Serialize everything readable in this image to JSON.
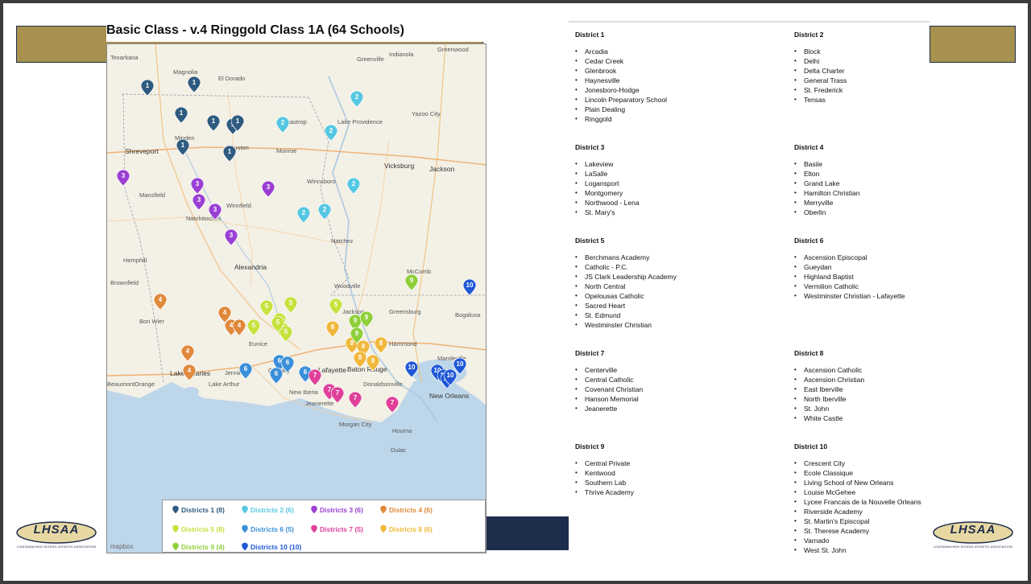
{
  "title": "Basic Class - v.4 Ringgold Class 1A (64 Schools)",
  "logo": {
    "text": "LHSAA",
    "subtitle": "LOUISIANA HIGH SCHOOL ATHLETIC ASSOCIATION"
  },
  "map": {
    "attribution": "mapbox",
    "colors": {
      "1": "#2f5b80",
      "2": "#56c7e2",
      "3": "#9b3fd4",
      "4": "#e0893b",
      "5": "#c6e23f",
      "6": "#3a8fd8",
      "7": "#e0409a",
      "8": "#f0b83a",
      "9": "#8fcf3a",
      "10": "#1f57d6"
    },
    "places": [
      "Texarkana",
      "Magnolia",
      "El Dorado",
      "Greenville",
      "Indianola",
      "Greenwood",
      "Bastrop",
      "Lake Providence",
      "Yazoo City",
      "Minden",
      "Ruston",
      "Monroe",
      "Shreveport",
      "Vicksburg",
      "Jackson",
      "Winnsboro",
      "Mansfield",
      "Winnfield",
      "Natchitoches",
      "Natchez",
      "Alexandria",
      "Hemphill",
      "Brownfield",
      "McComb",
      "Woodville",
      "Bon Wier",
      "Jackson",
      "Greensburg",
      "Bogalusa",
      "Eunice",
      "Crowley",
      "Lafayette",
      "Baton Rouge",
      "Hammond",
      "Mandeville",
      "Lake Charles",
      "Jennings",
      "Orange",
      "Beaumont",
      "New Iberia",
      "Jeanerette",
      "Donaldsonville",
      "New Orleans",
      "Morgan City",
      "Houma",
      "Dulac",
      "Lake Arthur"
    ],
    "pins": [
      {
        "d": "1"
      },
      {
        "d": "1"
      },
      {
        "d": "1"
      },
      {
        "d": "1"
      },
      {
        "d": "1"
      },
      {
        "d": "1"
      },
      {
        "d": "1"
      },
      {
        "d": "1"
      },
      {
        "d": "2"
      },
      {
        "d": "2"
      },
      {
        "d": "2"
      },
      {
        "d": "2"
      },
      {
        "d": "2"
      },
      {
        "d": "2"
      },
      {
        "d": "3"
      },
      {
        "d": "3"
      },
      {
        "d": "3"
      },
      {
        "d": "3"
      },
      {
        "d": "3"
      },
      {
        "d": "3"
      },
      {
        "d": "4"
      },
      {
        "d": "4"
      },
      {
        "d": "4"
      },
      {
        "d": "4"
      },
      {
        "d": "4"
      },
      {
        "d": "4"
      },
      {
        "d": "5"
      },
      {
        "d": "5"
      },
      {
        "d": "5"
      },
      {
        "d": "5"
      },
      {
        "d": "5"
      },
      {
        "d": "5"
      },
      {
        "d": "5"
      },
      {
        "d": "5"
      },
      {
        "d": "6"
      },
      {
        "d": "6"
      },
      {
        "d": "6"
      },
      {
        "d": "6"
      },
      {
        "d": "6"
      },
      {
        "d": "7"
      },
      {
        "d": "7"
      },
      {
        "d": "7"
      },
      {
        "d": "7"
      },
      {
        "d": "7"
      },
      {
        "d": "8"
      },
      {
        "d": "8"
      },
      {
        "d": "8"
      },
      {
        "d": "8"
      },
      {
        "d": "8"
      },
      {
        "d": "8"
      },
      {
        "d": "9"
      },
      {
        "d": "9"
      },
      {
        "d": "9"
      },
      {
        "d": "9"
      },
      {
        "d": "10"
      },
      {
        "d": "10"
      },
      {
        "d": "10"
      },
      {
        "d": "10"
      },
      {
        "d": "10"
      },
      {
        "d": "10"
      },
      {
        "d": "10"
      }
    ],
    "legend": [
      {
        "d": "1",
        "label": "Districts 1 (8)"
      },
      {
        "d": "2",
        "label": "Districts 2 (6)"
      },
      {
        "d": "3",
        "label": "Districts 3 (6)"
      },
      {
        "d": "4",
        "label": "Districts 4 (6)"
      },
      {
        "d": "5",
        "label": "Districts 5 (8)"
      },
      {
        "d": "6",
        "label": "Districts 6 (5)"
      },
      {
        "d": "7",
        "label": "Districts 7 (5)"
      },
      {
        "d": "8",
        "label": "Districts 8 (6)"
      },
      {
        "d": "9",
        "label": "Districts 9 (4)"
      },
      {
        "d": "10",
        "label": "Districts 10 (10)"
      }
    ]
  },
  "districts": [
    {
      "name": "District 1",
      "schools": [
        "Arcadia",
        "Cedar Creek",
        "Glenbrook",
        "Haynesville",
        "Jonesboro-Hodge",
        "Lincoln Preparatory School",
        "Plain Dealing",
        "Ringgold"
      ]
    },
    {
      "name": "District 2",
      "schools": [
        "Block",
        "Delhi",
        "Delta Charter",
        "General Trass",
        "St. Frederick",
        "Tensas"
      ]
    },
    {
      "name": "District 3",
      "schools": [
        "Lakeview",
        "LaSalle",
        "Logansport",
        "Montgomery",
        "Northwood - Lena",
        "St. Mary's"
      ]
    },
    {
      "name": "District 4",
      "schools": [
        "Basile",
        "Elton",
        "Grand Lake",
        "Hamilton Christian",
        "Merryville",
        "Oberlin"
      ]
    },
    {
      "name": "District 5",
      "schools": [
        "Berchmans Academy",
        "Catholic - P.C.",
        "JS Clark Leadership Academy",
        "North Central",
        "Opelousas Catholic",
        "Sacred Heart",
        "St. Edmund",
        "Westminster Christian"
      ]
    },
    {
      "name": "District 6",
      "schools": [
        "Ascension Episcopal",
        "Gueydan",
        "Highland Baptist",
        "Vermilion Catholic",
        "Westminster Christian - Lafayette"
      ]
    },
    {
      "name": "District 7",
      "schools": [
        "Centerville",
        "Central Catholic",
        "Covenant Christian",
        "Hanson Memorial",
        "Jeanerette"
      ]
    },
    {
      "name": "District 8",
      "schools": [
        "Ascension Catholic",
        "Ascension Christian",
        "East Iberville",
        "North Iberville",
        "St. John",
        "White Castle"
      ]
    },
    {
      "name": "District 9",
      "schools": [
        "Central Private",
        "Kentwood",
        "Southern Lab",
        "Thrive Academy"
      ]
    },
    {
      "name": "District 10",
      "schools": [
        "Crescent City",
        "Ecole Classique",
        "Living School of New Orleans",
        "Louise McGehee",
        "Lycee Francais de la Nouvelle Orleans",
        "Riverside Academy",
        "St. Martin's Episcopal",
        "St. Therese Academy",
        "Varnado",
        "West St. John"
      ]
    }
  ]
}
